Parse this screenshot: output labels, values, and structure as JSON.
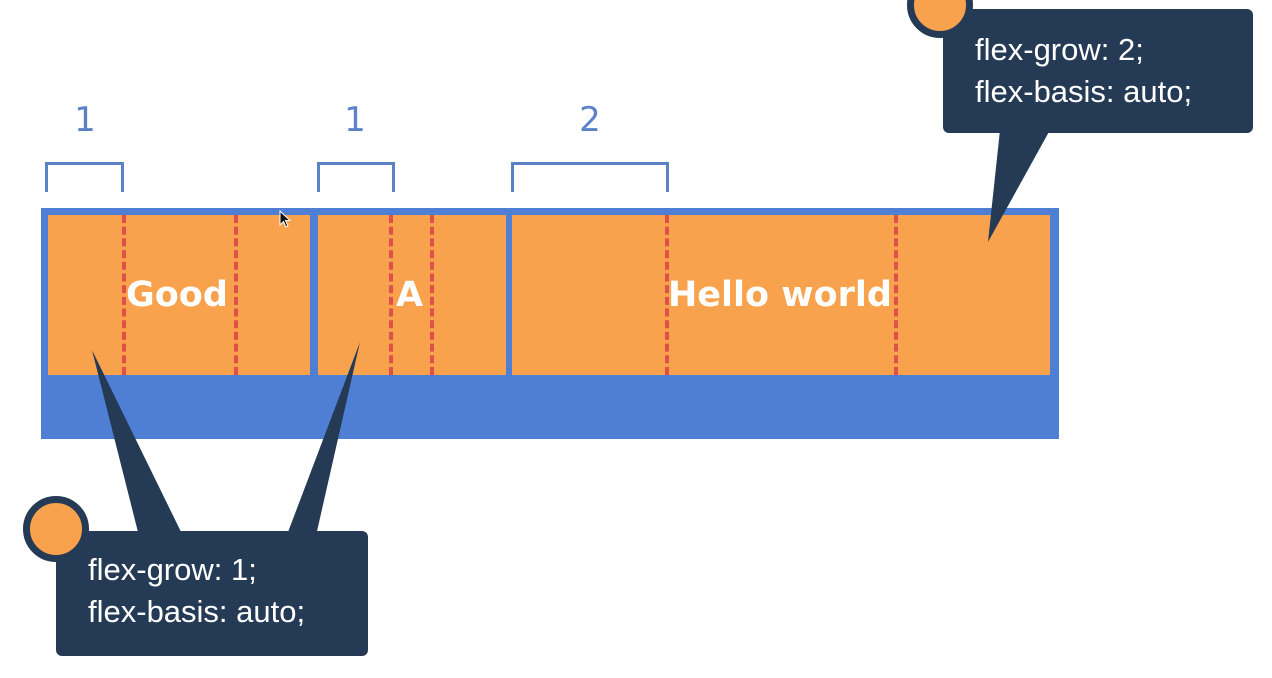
{
  "grow_labels": [
    "1",
    "1",
    "2"
  ],
  "items": {
    "good": "Good",
    "a": "A",
    "hello": "Hello world"
  },
  "callout_right": {
    "line1": "flex-grow: 2;",
    "line2": "flex-basis: auto;"
  },
  "callout_left": {
    "line1": "flex-grow: 1;",
    "line2": "flex-basis: auto;"
  },
  "colors": {
    "container": "#4f7fd4",
    "item": "#f9a24d",
    "callout": "#253a55",
    "dash": "#e0504a",
    "label": "#5b82c7"
  },
  "cursor_icon": "arrow-cursor-icon"
}
